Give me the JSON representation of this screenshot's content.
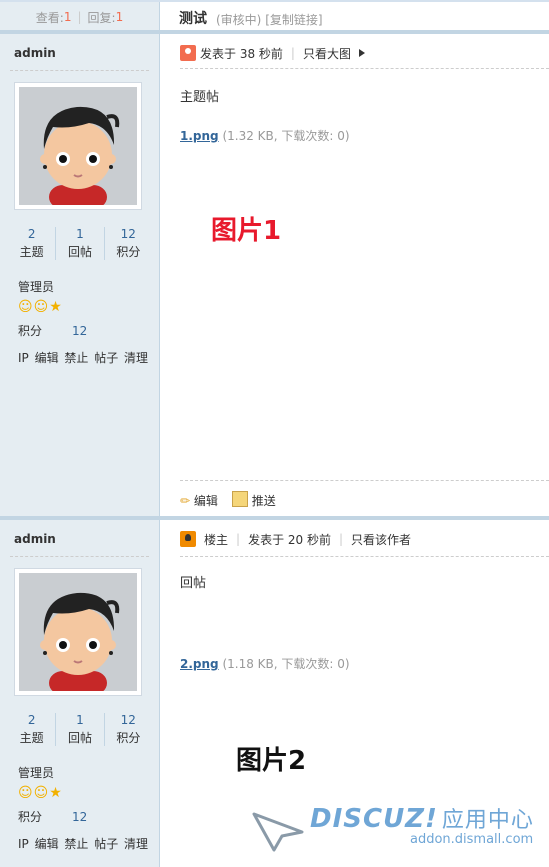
{
  "thread": {
    "views_label": "查看:",
    "views": "1",
    "replies_label": "回复:",
    "replies": "1",
    "title": "测试",
    "status": "(审核中)",
    "copy_link": "[复制链接]"
  },
  "posts": [
    {
      "author": "admin",
      "stats": [
        {
          "n": "2",
          "l": "主题"
        },
        {
          "n": "1",
          "l": "回帖"
        },
        {
          "n": "12",
          "l": "积分"
        }
      ],
      "role": "管理员",
      "points_label": "积分",
      "points": "12",
      "links": "IP 编辑 禁止 帖子 清理",
      "posted": "发表于 38 秒前",
      "view_option": "只看大图",
      "body": "主题帖",
      "attachment": {
        "name": "1.png",
        "info": "(1.32 KB, 下载次数: 0)"
      },
      "marker": "图片1",
      "edit_label": "编辑",
      "push_label": "推送"
    },
    {
      "author": "admin",
      "stats": [
        {
          "n": "2",
          "l": "主题"
        },
        {
          "n": "1",
          "l": "回帖"
        },
        {
          "n": "12",
          "l": "积分"
        }
      ],
      "role": "管理员",
      "points_label": "积分",
      "points": "12",
      "links": "IP 编辑 禁止 帖子 清理",
      "badge": "楼主",
      "posted": "发表于 20 秒前",
      "view_option": "只看该作者",
      "body": "回帖",
      "attachment": {
        "name": "2.png",
        "info": "(1.18 KB, 下载次数: 0)"
      },
      "marker": "图片2"
    }
  ],
  "watermark": {
    "logo": "DISCUZ!",
    "logo_cn": "应用中心",
    "url": "addon.dismall.com"
  },
  "colors": {
    "marker1": "#e8192c",
    "marker2": "#111111",
    "accent": "#336699",
    "sidebar": "#e5edf2"
  }
}
